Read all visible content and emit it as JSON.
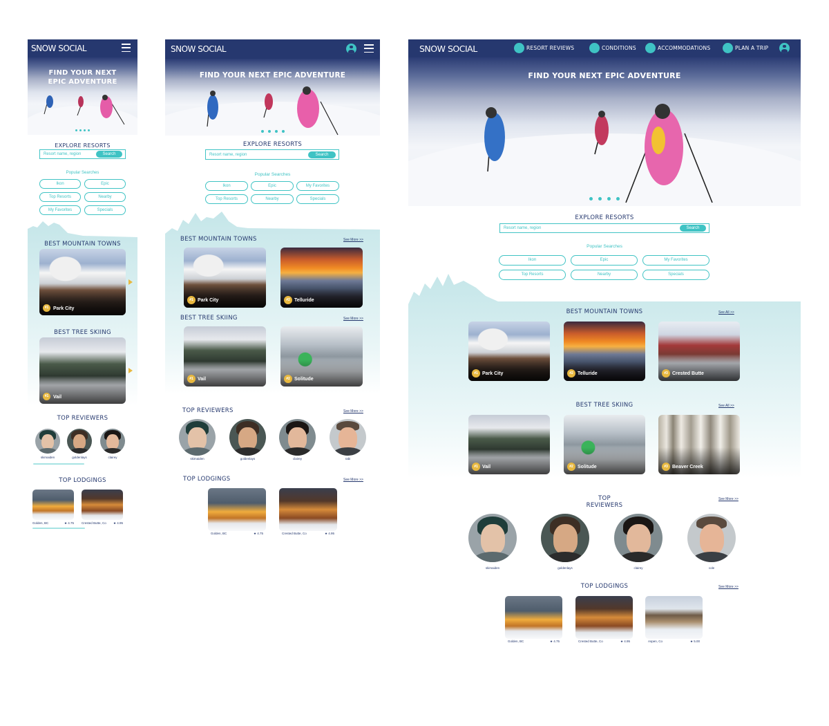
{
  "brand": "SNOW SOCIAL",
  "hero_title": "FIND YOUR NEXT EPIC ADVENTURE",
  "hero_title_mobile_l1": "FIND YOUR NEXT",
  "hero_title_mobile_l2": "EPIC ADVENTURE",
  "nav": {
    "resort_reviews": "RESORT REVIEWS",
    "conditions": "CONDITIONS",
    "accommodations": "ACCOMMODATIONS",
    "plan_a_trip": "PLAN A TRIP"
  },
  "explore": {
    "title": "EXPLORE RESORTS",
    "placeholder": "Resort name, region",
    "search_label": "Search",
    "popular_label": "Popular Searches",
    "pills": [
      "Ikon",
      "Epic",
      "My Favorites",
      "Top Resorts",
      "Nearby",
      "Specials"
    ]
  },
  "sections": {
    "towns": "BEST MOUNTAIN TOWNS",
    "tree": "BEST TREE SKIING",
    "reviewers": "TOP REVIEWERS",
    "reviewers_l1": "TOP",
    "reviewers_l2": "REVIEWERS",
    "lodgings": "TOP LODGINGS",
    "see_more": "See More >>",
    "see_all": "See All >>"
  },
  "towns": [
    {
      "rank": "#1",
      "name": "Park City"
    },
    {
      "rank": "#2",
      "name": "Telluride"
    },
    {
      "rank": "#3",
      "name": "Crested Butte"
    }
  ],
  "tree_skiing": [
    {
      "rank": "#1",
      "name": "Vail"
    },
    {
      "rank": "#2",
      "name": "Solitude"
    },
    {
      "rank": "#3",
      "name": "Beaver Creek"
    }
  ],
  "reviewers": [
    "skimaiden",
    "goldenlays",
    "clairey",
    "rabi"
  ],
  "reviewers_desktop": [
    "skimaiden",
    "goldenlays",
    "clairey",
    "cole"
  ],
  "lodgings": [
    {
      "place": "Golden, BC",
      "rating": "★ 4.75"
    },
    {
      "place": "Crested Butte, Co",
      "rating": "★ 4.95"
    },
    {
      "place": "Aspen, Co",
      "rating": "★ 5.00"
    }
  ],
  "colors": {
    "navy": "#26386f",
    "teal": "#3fc3c4",
    "mint": "#d2ecee",
    "gold": "#e8b83f"
  }
}
